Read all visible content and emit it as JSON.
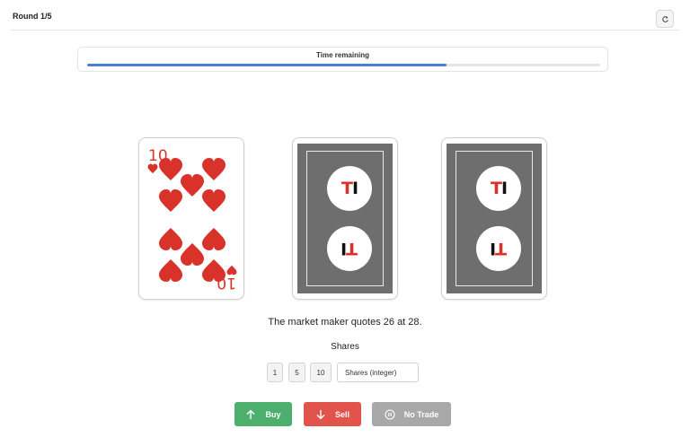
{
  "header": {
    "round_label": "Round 1/5",
    "reset_icon": "refresh-icon"
  },
  "timer": {
    "label": "Time remaining",
    "fraction_remaining": 0.7
  },
  "cards": [
    {
      "type": "face",
      "rank": "10",
      "suit": "hearts",
      "suit_color": "#d8322b"
    },
    {
      "type": "back",
      "logo_text": "TI",
      "logo_letter_1": "T",
      "logo_letter_2": "I",
      "logo_color_1": "#d8322b",
      "logo_color_2": "#111111",
      "back_color": "#6e6e6e"
    },
    {
      "type": "back",
      "logo_text": "TI",
      "logo_letter_1": "T",
      "logo_letter_2": "I",
      "logo_color_1": "#d8322b",
      "logo_color_2": "#111111",
      "back_color": "#6e6e6e"
    }
  ],
  "quote_text": "The market maker quotes 26 at 28.",
  "shares": {
    "label": "Shares",
    "quick_amounts": [
      "1",
      "5",
      "10"
    ],
    "input_placeholder": "Shares (integer)",
    "input_value": ""
  },
  "actions": {
    "buy_label": "Buy",
    "buy_icon": "arrow-up-icon",
    "buy_color": "#4caf6e",
    "sell_label": "Sell",
    "sell_icon": "arrow-down-icon",
    "sell_color": "#e2544b",
    "no_trade_label": "No Trade",
    "no_trade_icon": "pause-circle-icon",
    "no_trade_color": "#a8a8a8"
  }
}
